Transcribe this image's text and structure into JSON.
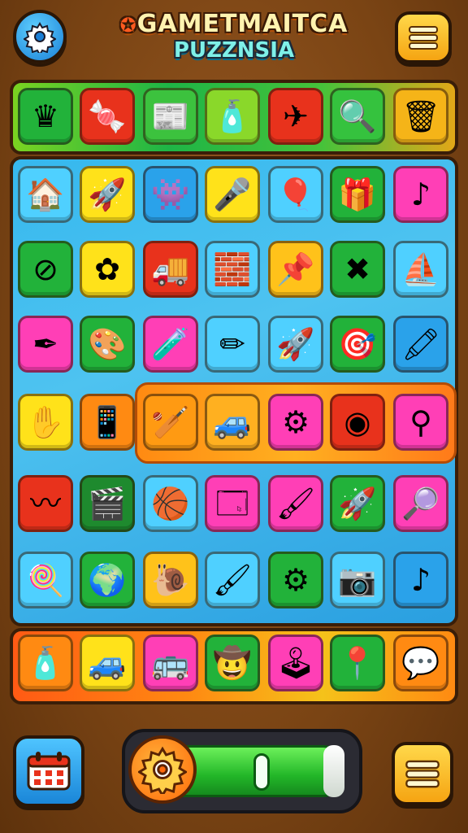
{
  "title": {
    "line1": "GAMETMAITCA",
    "line2": "PUZZNSIA"
  },
  "colors": {
    "accent": "#ff8a12",
    "board_blue": "#36b8ee",
    "progress_green": "#22b628"
  },
  "top_buttons": {
    "settings_icon": "gear-icon",
    "menu_icon": "hamburger-menu-icon"
  },
  "top_row": [
    {
      "icon": "crown-icon",
      "glyph": "♛",
      "bg": "#22b23a"
    },
    {
      "icon": "swirl-candy-icon",
      "glyph": "🍬",
      "bg": "#e8321c"
    },
    {
      "icon": "newspaper-icon",
      "glyph": "📰",
      "bg": "#3cc23e"
    },
    {
      "icon": "bottle-icon",
      "glyph": "🧴",
      "bg": "#8ad82a"
    },
    {
      "icon": "paper-plane-icon",
      "glyph": "✈",
      "bg": "#e8321c"
    },
    {
      "icon": "magnifier-ball-icon",
      "glyph": "🔍",
      "bg": "#35c23e"
    },
    {
      "icon": "trash-bin-icon",
      "glyph": "🗑",
      "bg": "#f5b418"
    }
  ],
  "grid": [
    [
      {
        "icon": "house-icon",
        "glyph": "🏠",
        "bg": "#4fd0ff"
      },
      {
        "icon": "rocket-icon",
        "glyph": "🚀",
        "bg": "#ffe21a"
      },
      {
        "icon": "monster-icon",
        "glyph": "👾",
        "bg": "#2aa2ea"
      },
      {
        "icon": "microphone-icon",
        "glyph": "🎤",
        "bg": "#ffe21a"
      },
      {
        "icon": "balloon-icon",
        "glyph": "🎈",
        "bg": "#4fd0ff"
      },
      {
        "icon": "gift-box-icon",
        "glyph": "🎁",
        "bg": "#22b23a"
      },
      {
        "icon": "music-note-icon",
        "glyph": "♪",
        "bg": "#ff3fb6"
      }
    ],
    [
      {
        "icon": "no-sign-icon",
        "glyph": "⊘",
        "bg": "#22b23a"
      },
      {
        "icon": "gear-flower-icon",
        "glyph": "✿",
        "bg": "#ffe21a"
      },
      {
        "icon": "truck-icon",
        "glyph": "🚚",
        "bg": "#e8321c"
      },
      {
        "icon": "building-blocks-icon",
        "glyph": "🧱",
        "bg": "#4fd0ff"
      },
      {
        "icon": "pushpin-icon",
        "glyph": "📌",
        "bg": "#ffc21a"
      },
      {
        "icon": "cross-tools-icon",
        "glyph": "✖",
        "bg": "#22b23a"
      },
      {
        "icon": "boat-icon",
        "glyph": "⛵",
        "bg": "#4fd0ff"
      }
    ],
    [
      {
        "icon": "pen-icon",
        "glyph": "✒",
        "bg": "#ff3fb6"
      },
      {
        "icon": "paint-palette-icon",
        "glyph": "🎨",
        "bg": "#22b23a"
      },
      {
        "icon": "spray-bottle-icon",
        "glyph": "🧪",
        "bg": "#ff3fb6"
      },
      {
        "icon": "pencil-icon",
        "glyph": "✏",
        "bg": "#4fd0ff"
      },
      {
        "icon": "rocket-ship-icon",
        "glyph": "🚀",
        "bg": "#4fd0ff"
      },
      {
        "icon": "target-icon",
        "glyph": "🎯",
        "bg": "#22b23a"
      },
      {
        "icon": "crayon-icon",
        "glyph": "🖍",
        "bg": "#2aa2ea"
      }
    ],
    [
      {
        "icon": "hand-icon",
        "glyph": "✋",
        "bg": "#ffe21a"
      },
      {
        "icon": "phone-icon",
        "glyph": "📱",
        "bg": "#ff8a12"
      },
      {
        "icon": "bat-icon",
        "glyph": "🏏",
        "bg": "#ff9a12"
      },
      {
        "icon": "car-icon",
        "glyph": "🚙",
        "bg": "#ffb020"
      },
      {
        "icon": "gear-icon",
        "glyph": "⚙",
        "bg": "#ff3fb6"
      },
      {
        "icon": "color-wheel-icon",
        "glyph": "◉",
        "bg": "#e8321c"
      },
      {
        "icon": "hook-icon",
        "glyph": "⚲",
        "bg": "#ff3fb6"
      }
    ],
    [
      {
        "icon": "worm-icon",
        "glyph": "〰",
        "bg": "#e8321c"
      },
      {
        "icon": "film-ball-icon",
        "glyph": "🎬",
        "bg": "#1e8a2e"
      },
      {
        "icon": "ball-icon",
        "glyph": "🏀",
        "bg": "#4fd0ff"
      },
      {
        "icon": "window-icon",
        "glyph": "🗔",
        "bg": "#ff3fb6"
      },
      {
        "icon": "brush-icon",
        "glyph": "🖌",
        "bg": "#ff3fb6"
      },
      {
        "icon": "rocket-small-icon",
        "glyph": "🚀",
        "bg": "#22b23a"
      },
      {
        "icon": "search-gear-icon",
        "glyph": "🔎",
        "bg": "#ff3fb6"
      }
    ],
    [
      {
        "icon": "candy-icon",
        "glyph": "🍭",
        "bg": "#4fd0ff"
      },
      {
        "icon": "globe-magnifier-icon",
        "glyph": "🌍",
        "bg": "#22b23a"
      },
      {
        "icon": "snail-icon",
        "glyph": "🐌",
        "bg": "#ffc21a"
      },
      {
        "icon": "paintbrush-icon",
        "glyph": "🖌",
        "bg": "#4fd0ff"
      },
      {
        "icon": "compass-gear-icon",
        "glyph": "⚙",
        "bg": "#22b23a"
      },
      {
        "icon": "camera-icon",
        "glyph": "📷",
        "bg": "#4fd0ff"
      },
      {
        "icon": "note-drop-icon",
        "glyph": "♪",
        "bg": "#2aa2ea"
      }
    ]
  ],
  "bottom_row": [
    {
      "icon": "potion-bottle-icon",
      "glyph": "🧴",
      "bg": "#ff8a12"
    },
    {
      "icon": "jeep-icon",
      "glyph": "🚙",
      "bg": "#ffe21a"
    },
    {
      "icon": "bus-icon",
      "glyph": "🚌",
      "bg": "#ff3fb6"
    },
    {
      "icon": "cowboy-face-icon",
      "glyph": "🤠",
      "bg": "#22b23a"
    },
    {
      "icon": "joystick-icon",
      "glyph": "🕹",
      "bg": "#ff3fb6"
    },
    {
      "icon": "map-pin-icon",
      "glyph": "📍",
      "bg": "#22b23a"
    },
    {
      "icon": "chat-bubble-icon",
      "glyph": "💬",
      "bg": "#ff8a12"
    }
  ],
  "footer": {
    "calendar_icon": "calendar-icon",
    "menu_icon": "hamburger-menu-icon",
    "progress": 0.55
  }
}
